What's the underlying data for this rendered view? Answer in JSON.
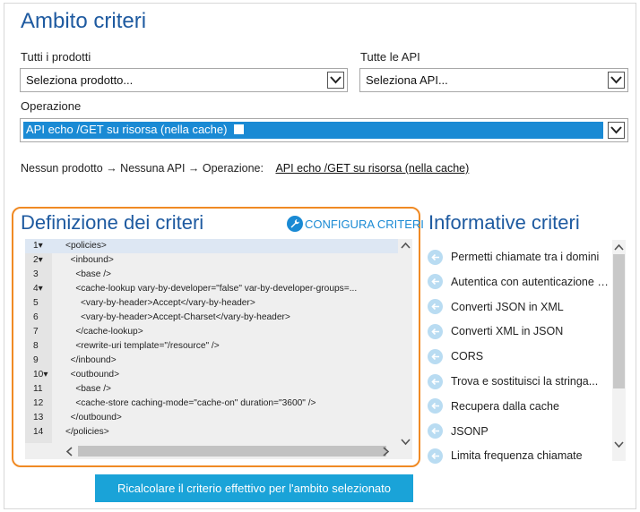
{
  "header": {
    "title": "Ambito criteri"
  },
  "filters": {
    "products_label": "Tutti i prodotti",
    "products_value": "Seleziona prodotto...",
    "apis_label": "Tutte le API",
    "apis_value": "Seleziona API...",
    "operation_label": "Operazione",
    "operation_value": "API echo /GET su risorsa (nella cache)"
  },
  "scope_path": {
    "prefix": "Nessun prodotto → Nessuna API → Operazione:",
    "link": "API echo /GET su risorsa (nella cache)"
  },
  "policy_definition": {
    "title": "Definizione dei criteri",
    "configure_label": "CONFIGURA CRITERI",
    "lines": [
      {
        "num": "1▾",
        "text": "<policies>"
      },
      {
        "num": "2▾",
        "text": "  <inbound>"
      },
      {
        "num": "3",
        "text": "    <base />"
      },
      {
        "num": "4▾",
        "text": "    <cache-lookup vary-by-developer=\"false\" var-by-developer-groups=..."
      },
      {
        "num": "5",
        "text": "      <vary-by-header>Accept</vary-by-header>"
      },
      {
        "num": "6",
        "text": "      <vary-by-header>Accept-Charset</vary-by-header>"
      },
      {
        "num": "7",
        "text": "    </cache-lookup>"
      },
      {
        "num": "8",
        "text": "    <rewrite-uri template=\"/resource\" />"
      },
      {
        "num": "9",
        "text": "  </inbound>"
      },
      {
        "num": "10▾",
        "text": "  <outbound>"
      },
      {
        "num": "11",
        "text": "    <base />"
      },
      {
        "num": "12",
        "text": "    <cache-store caching-mode=\"cache-on\" duration=\"3600\" />"
      },
      {
        "num": "13",
        "text": "  </outbound>"
      },
      {
        "num": "14",
        "text": "</policies>"
      }
    ]
  },
  "snippets": {
    "title": "Informative criteri",
    "items": [
      "Permetti chiamate tra i domini",
      "Autentica con autenticazione d...",
      "Converti JSON in XML",
      "Converti XML in JSON",
      "CORS",
      "Trova e sostituisci la stringa...",
      "Recupera dalla cache",
      "JSONP",
      "Limita frequenza chiamate"
    ]
  },
  "actions": {
    "recalculate": "Ricalcolare il criterio effettivo per l'ambito selezionato"
  },
  "colors": {
    "accent": "#1e5aa0",
    "highlight": "#1a8ad4",
    "orange_border": "#f08a24",
    "button": "#1aa3d8"
  }
}
